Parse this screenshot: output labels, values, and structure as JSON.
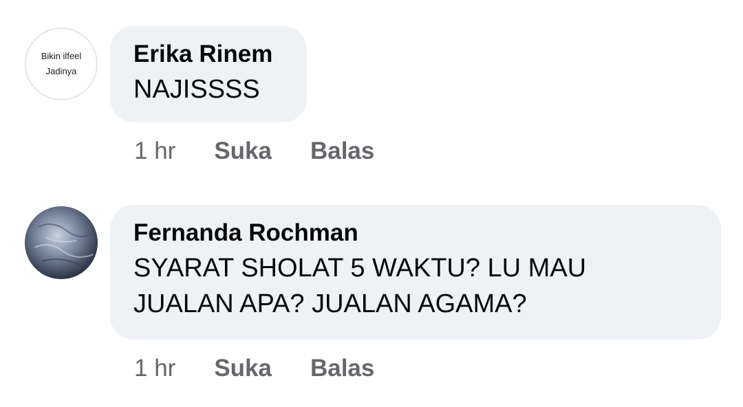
{
  "comments": [
    {
      "avatar_text_line1": "Bikin ilfeel",
      "avatar_text_line2": "Jadinya",
      "author": "Erika Rinem",
      "text": "NAJISSSS",
      "time": "1 hr",
      "like_label": "Suka",
      "reply_label": "Balas"
    },
    {
      "author": "Fernanda Rochman",
      "text_line1": "SYARAT SHOLAT 5 WAKTU? LU MAU",
      "text_line2": "JUALAN APA? JUALAN AGAMA?",
      "time": "1 hr",
      "like_label": "Suka",
      "reply_label": "Balas"
    }
  ],
  "colors": {
    "bubble_bg": "#eff2f5",
    "author_text": "#050505",
    "meta_text": "#65676b"
  }
}
